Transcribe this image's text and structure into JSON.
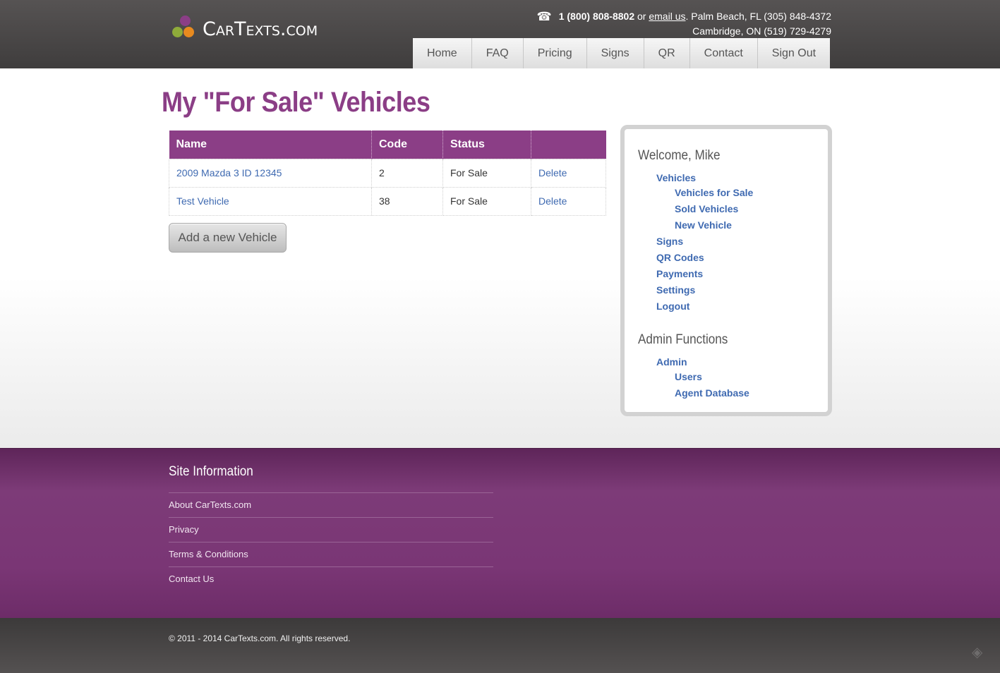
{
  "header": {
    "logo_text": "CarTexts.com",
    "phone_icon": "telephone-icon",
    "phone": "1 (800) 808-8802",
    "or_text": " or ",
    "email_link": "email us",
    "line1_rest": ". Palm Beach, FL (305) 848-4372",
    "line2": "Cambridge, ON (519) 729-4279",
    "nav": [
      "Home",
      "FAQ",
      "Pricing",
      "Signs",
      "QR",
      "Contact",
      "Sign Out"
    ]
  },
  "main": {
    "title": "My \"For Sale\" Vehicles",
    "table": {
      "headers": [
        "Name",
        "Code",
        "Status",
        ""
      ],
      "rows": [
        {
          "name": "2009 Mazda 3 ID 12345",
          "code": "2",
          "status": "For Sale",
          "action": "Delete"
        },
        {
          "name": "Test Vehicle",
          "code": "38",
          "status": "For Sale",
          "action": "Delete"
        }
      ]
    },
    "add_button": "Add a new Vehicle"
  },
  "sidebar": {
    "welcome": "Welcome, Mike",
    "vehicles": "Vehicles",
    "vehicles_for_sale": "Vehicles for Sale",
    "sold_vehicles": "Sold Vehicles",
    "new_vehicle": "New Vehicle",
    "signs": "Signs",
    "qr_codes": "QR Codes",
    "payments": "Payments",
    "settings": "Settings",
    "logout": "Logout",
    "admin_heading": "Admin Functions",
    "admin": "Admin",
    "users": "Users",
    "agent_database": "Agent Database"
  },
  "footer": {
    "heading": "Site Information",
    "links": [
      "About CarTexts.com",
      "Privacy",
      "Terms & Conditions",
      "Contact Us"
    ],
    "copyright": "© 2011 - 2014 CarTexts.com. All rights reserved."
  },
  "colors": {
    "brand_purple": "#8b3e86",
    "link_blue": "#3f6ab1",
    "header_dark": "#4a4747"
  }
}
